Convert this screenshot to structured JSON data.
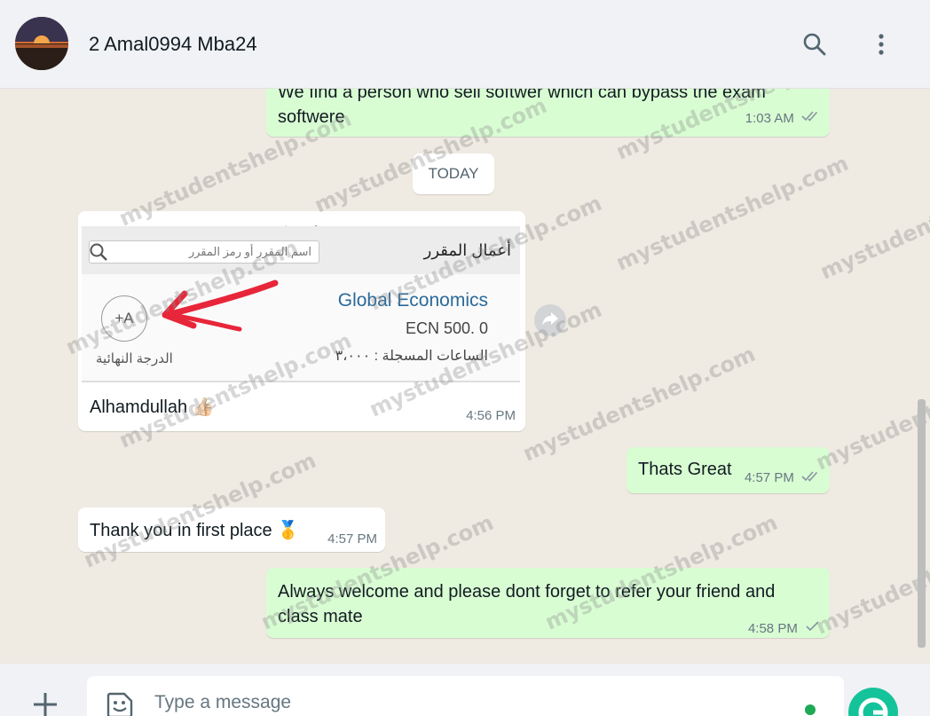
{
  "header": {
    "title": "2 Amal0994 Mba24",
    "search_icon": "search-icon",
    "menu_icon": "kebab-menu-icon"
  },
  "messages": [
    {
      "id": "m0",
      "direction": "out",
      "text": "We find a person who sell softwer which can bypass the exam softwere",
      "time": "1:03 AM",
      "status": "read"
    },
    {
      "id": "m1",
      "direction": "in",
      "type": "image",
      "caption": "Alhamdullah 👍🏻",
      "time": "4:56 PM"
    },
    {
      "id": "m2",
      "direction": "out",
      "text": "Thats Great",
      "time": "4:57 PM",
      "status": "read"
    },
    {
      "id": "m3",
      "direction": "in",
      "text": "Thank you in first place 🥇",
      "time": "4:57 PM"
    },
    {
      "id": "m4",
      "direction": "out",
      "text": "Always welcome and please dont forget to refer your friend and class mate",
      "time": "4:58 PM",
      "status": "sent"
    }
  ],
  "day_divider": "TODAY",
  "image_card": {
    "heading": "أعمال المقرر",
    "search_placeholder": "اسم المقرر أو رمز المقرر",
    "course_name": "Global Economics",
    "course_code": "ECN 500. 0",
    "hours_text": "الساعات المسجلة : ٣،٠٠٠",
    "grade": "+A",
    "grade_label": "الدرجة النهائية"
  },
  "composer": {
    "placeholder": "Type a message"
  },
  "watermark": "mystudentshelp.com",
  "colors": {
    "outgoing": "#d9fdd3",
    "incoming": "#ffffff",
    "background": "#efeae2",
    "read_tick": "#53bdeb"
  }
}
